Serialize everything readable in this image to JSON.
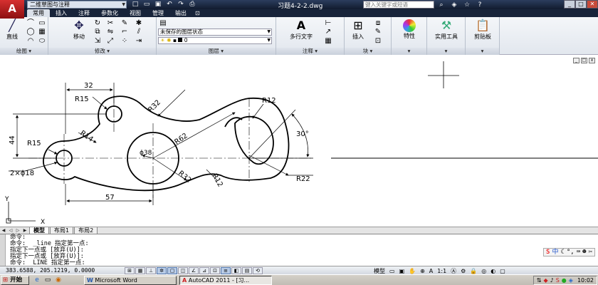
{
  "titlebar": {
    "logo": "A",
    "workspace": "二维草图与注释",
    "doc_title": "习题4-2-2.dwg",
    "search_placeholder": "键入关键字或短语",
    "qat_icons": [
      "new-icon",
      "open-icon",
      "save-icon",
      "undo-icon",
      "redo-icon",
      "print-icon"
    ]
  },
  "ribbon_tabs": [
    "常用",
    "插入",
    "注释",
    "参数化",
    "视图",
    "管理",
    "输出"
  ],
  "ribbon": {
    "draw": {
      "label": "绘图",
      "line": "直线"
    },
    "modify": {
      "label": "修改",
      "move": "移动"
    },
    "layers": {
      "label": "图层",
      "state": "未保存的图层状态",
      "current": "0"
    },
    "annotation": {
      "label": "注释",
      "mtext": "多行文字"
    },
    "block": {
      "label": "块",
      "insert": "插入"
    },
    "properties": {
      "label": "特性"
    },
    "utilities": {
      "label": "实用工具"
    },
    "clipboard": {
      "label": "剪贴板"
    }
  },
  "drawing": {
    "dims": {
      "d32": "32",
      "r15_top": "R15",
      "r32_top": "R32",
      "r12_top": "R12",
      "d44": "44",
      "r14": "R14",
      "r62": "R62",
      "a30": "30°",
      "r15_left": "R15",
      "d38": "ϕ38",
      "hole2": "2×ϕ18",
      "r32_bot": "R32",
      "r12_bot": "R12",
      "r22": "R22",
      "d57": "57"
    },
    "ucs_y": "Y",
    "ucs_x": "X"
  },
  "layout_tabs": [
    "模型",
    "布局1",
    "布局2"
  ],
  "command_lines": [
    "命令:",
    "命令:  _line 指定第一点:",
    "指定下一点或 [放弃(U)]:",
    "指定下一点或 [放弃(U)]:",
    "命令:  LINE 指定第一点:"
  ],
  "ime": {
    "label": "中"
  },
  "statusbar": {
    "coords": "383.6588, 205.1219, 0.0000",
    "model": "模型",
    "scale": "1:1"
  },
  "taskbar": {
    "start": "开始",
    "word": "Microsoft Word",
    "autocad": "AutoCAD 2011 - [习...",
    "clock": "10:02"
  }
}
